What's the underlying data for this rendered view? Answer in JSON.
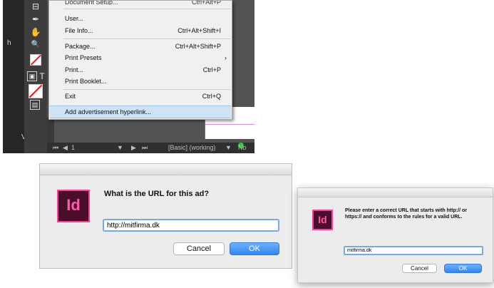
{
  "menu": {
    "items": [
      {
        "label": "Document Setup...",
        "shortcut": "Ctrl+Alt+P"
      },
      {
        "label": "User...",
        "shortcut": ""
      },
      {
        "label": "File Info...",
        "shortcut": "Ctrl+Alt+Shift+I"
      },
      {
        "label": "Package...",
        "shortcut": "Ctrl+Alt+Shift+P"
      },
      {
        "label": "Print Presets",
        "shortcut": ""
      },
      {
        "label": "Print...",
        "shortcut": "Ctrl+P"
      },
      {
        "label": "Print Booklet...",
        "shortcut": ""
      },
      {
        "label": "Exit",
        "shortcut": "Ctrl+Q"
      },
      {
        "label": "Add advertisement hyperlink...",
        "shortcut": ""
      }
    ],
    "submenu_arrow": "›",
    "highlight_color": "#cfe3f6"
  },
  "statusbar": {
    "first": "⏮",
    "prev": "◀",
    "page": "1",
    "dropdown": "▼",
    "next": "▶",
    "last": "⏭",
    "preflight_profile": "[Basic] (working)",
    "status_dropdown": "▼",
    "status_text": "No"
  },
  "left_strip": {
    "letter_h": "h",
    "letter_v": "V"
  },
  "tools": {
    "page_icon": "⊟",
    "pen_icon": "✒",
    "hand_icon": "✋",
    "zoom_icon": "🔍",
    "frame_icon": "▣",
    "text_icon": "T",
    "screen_mode_icon": "▤"
  },
  "dialog_url": {
    "app_icon_text": "Id",
    "question": "What is the URL for this ad?",
    "input_value": "http://mitfirma.dk",
    "cancel_label": "Cancel",
    "ok_label": "OK"
  },
  "dialog_error": {
    "app_icon_text": "Id",
    "message": "Please enter a correct URL that starts with http:// or https:// and conforms to the rules for a valid URL.",
    "input_value": "mitfirma.dk",
    "cancel_label": "Cancel",
    "ok_label": "OK"
  },
  "colors": {
    "indesign_icon_bg": "#4a0e2b",
    "indesign_icon_accent": "#ff3e9a",
    "ok_button_blue": "#2f86f2",
    "status_green": "#35c43a"
  }
}
